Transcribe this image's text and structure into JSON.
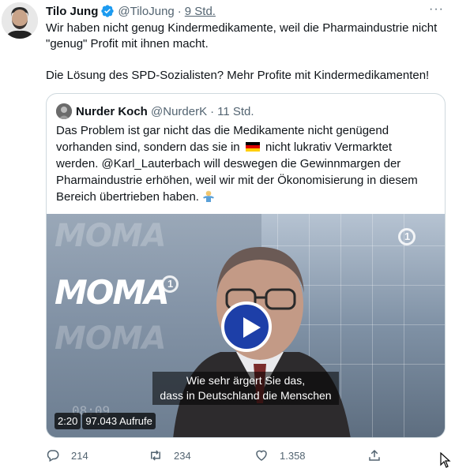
{
  "tweet": {
    "author_name": "Tilo Jung",
    "handle": "@TiloJung",
    "separator": "·",
    "time": "9 Std.",
    "more_label": "···",
    "text_line1": "Wir haben nicht genug Kindermedikamente, weil die Pharmaindustrie nicht",
    "text_line2": "\"genug\" Profit mit ihnen macht.",
    "text_line3": "Die Lösung des SPD-Sozialisten? Mehr Profite mit Kindermedikamenten!"
  },
  "quote": {
    "author_name": "Nurder Koch",
    "handle": "@NurderK",
    "separator": "·",
    "time": "11 Std.",
    "line1": "Das Problem ist gar nicht das die Medikamente nicht genügend",
    "line2_a": "vorhanden sind, sondern das sie in",
    "line2_b": "nicht lukrativ Vermarktet",
    "line3": "werden. @Karl_Lauterbach will deswegen die Gewinnmargen der",
    "line4": "Pharmaindustrie erhöhen, weil wir mit der Ökonomisierung in diesem",
    "line5": "Bereich übertrieben haben.",
    "flag_icon": "germany-flag-icon",
    "emoji_icon": "man-shrugging-emoji"
  },
  "video": {
    "logo_text": "MOMA",
    "channel_logo": "1",
    "clock_text": "08:09",
    "subtitle_line1": "Wie sehr ärgert Sie das,",
    "subtitle_line2": "dass in Deutschland die Menschen",
    "duration": "2:20",
    "views": "97.043 Aufrufe"
  },
  "actions": {
    "replies": "214",
    "retweets": "234",
    "likes": "1.358"
  },
  "colors": {
    "verified": "#1d9bf0",
    "secondary_text": "#536471",
    "play_button": "#1d3fa8",
    "border": "#cfd9de"
  }
}
